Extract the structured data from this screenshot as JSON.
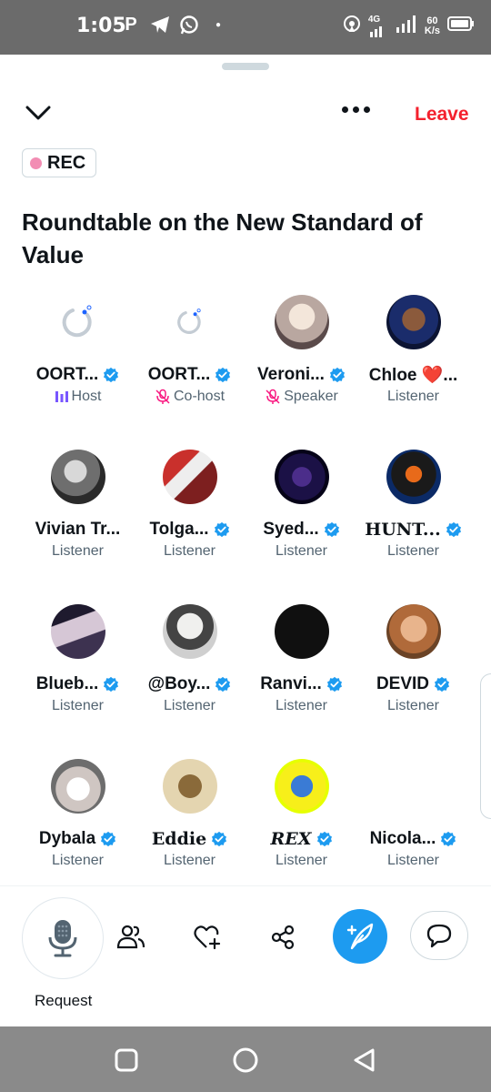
{
  "status_bar": {
    "time": "1:05",
    "left_icons": [
      "parking-p-icon",
      "telegram-icon",
      "whatsapp-icon",
      "dot-icon"
    ],
    "right_icons": [
      "hotspot-icon",
      "4g-signal-icon",
      "signal-icon",
      "speed-icon",
      "battery-icon"
    ],
    "network": "4G",
    "speed_value": "60",
    "speed_unit": "K/s"
  },
  "header": {
    "leave_label": "Leave",
    "rec_label": "REC",
    "title": "Roundtable on the New Standard of Value"
  },
  "participants": [
    {
      "name": "OORT...",
      "role": "Host",
      "verified": true,
      "role_icon": "host-bars-icon",
      "avatar": "oort-logo"
    },
    {
      "name": "OORT...",
      "role": "Co-host",
      "verified": true,
      "role_icon": "mic-muted-icon",
      "avatar": "oort-logo"
    },
    {
      "name": "Veroni...",
      "role": "Speaker",
      "verified": true,
      "role_icon": "mic-muted-icon",
      "avatar": "photo"
    },
    {
      "name": "Chloe ❤️...",
      "role": "Listener",
      "verified": false,
      "role_icon": "",
      "avatar": "photo"
    },
    {
      "name": "Vivian Tr...",
      "role": "Listener",
      "verified": false,
      "role_icon": "",
      "avatar": "photo"
    },
    {
      "name": "Tolga...",
      "role": "Listener",
      "verified": true,
      "role_icon": "",
      "avatar": "photo"
    },
    {
      "name": "Syed...",
      "role": "Listener",
      "verified": true,
      "role_icon": "",
      "avatar": "photo"
    },
    {
      "name": "HUNT...",
      "role": "Listener",
      "verified": true,
      "role_icon": "",
      "avatar": "photo"
    },
    {
      "name": "Blueb...",
      "role": "Listener",
      "verified": true,
      "role_icon": "",
      "avatar": "photo"
    },
    {
      "name": "@Boy...",
      "role": "Listener",
      "verified": true,
      "role_icon": "",
      "avatar": "photo"
    },
    {
      "name": "Ranvi...",
      "role": "Listener",
      "verified": true,
      "role_icon": "",
      "avatar": "photo"
    },
    {
      "name": "DEVID",
      "role": "Listener",
      "verified": true,
      "role_icon": "",
      "avatar": "photo"
    },
    {
      "name": "Dybala",
      "role": "Listener",
      "verified": true,
      "role_icon": "",
      "avatar": "photo"
    },
    {
      "name": "Eddie",
      "role": "Listener",
      "verified": true,
      "role_icon": "",
      "avatar": "photo"
    },
    {
      "name": "REX",
      "role": "Listener",
      "verified": true,
      "role_icon": "",
      "avatar": "photo"
    },
    {
      "name": "Nicola...",
      "role": "Listener",
      "verified": true,
      "role_icon": "",
      "avatar": "photo"
    }
  ],
  "toolbar": {
    "request_label": "Request",
    "icons": [
      "microphone-icon",
      "people-icon",
      "heart-add-icon",
      "share-icon",
      "compose-feather-icon",
      "chat-bubble-icon"
    ]
  },
  "colors": {
    "leave": "#f4212e",
    "rec_dot": "#f28db3",
    "verified": "#1d9bf0",
    "host_accent": "#7856ff",
    "muted_mic": "#f91880",
    "compose": "#1d9bf0"
  },
  "nav_bar": {
    "icons": [
      "recents-square-icon",
      "home-circle-icon",
      "back-triangle-icon"
    ]
  }
}
